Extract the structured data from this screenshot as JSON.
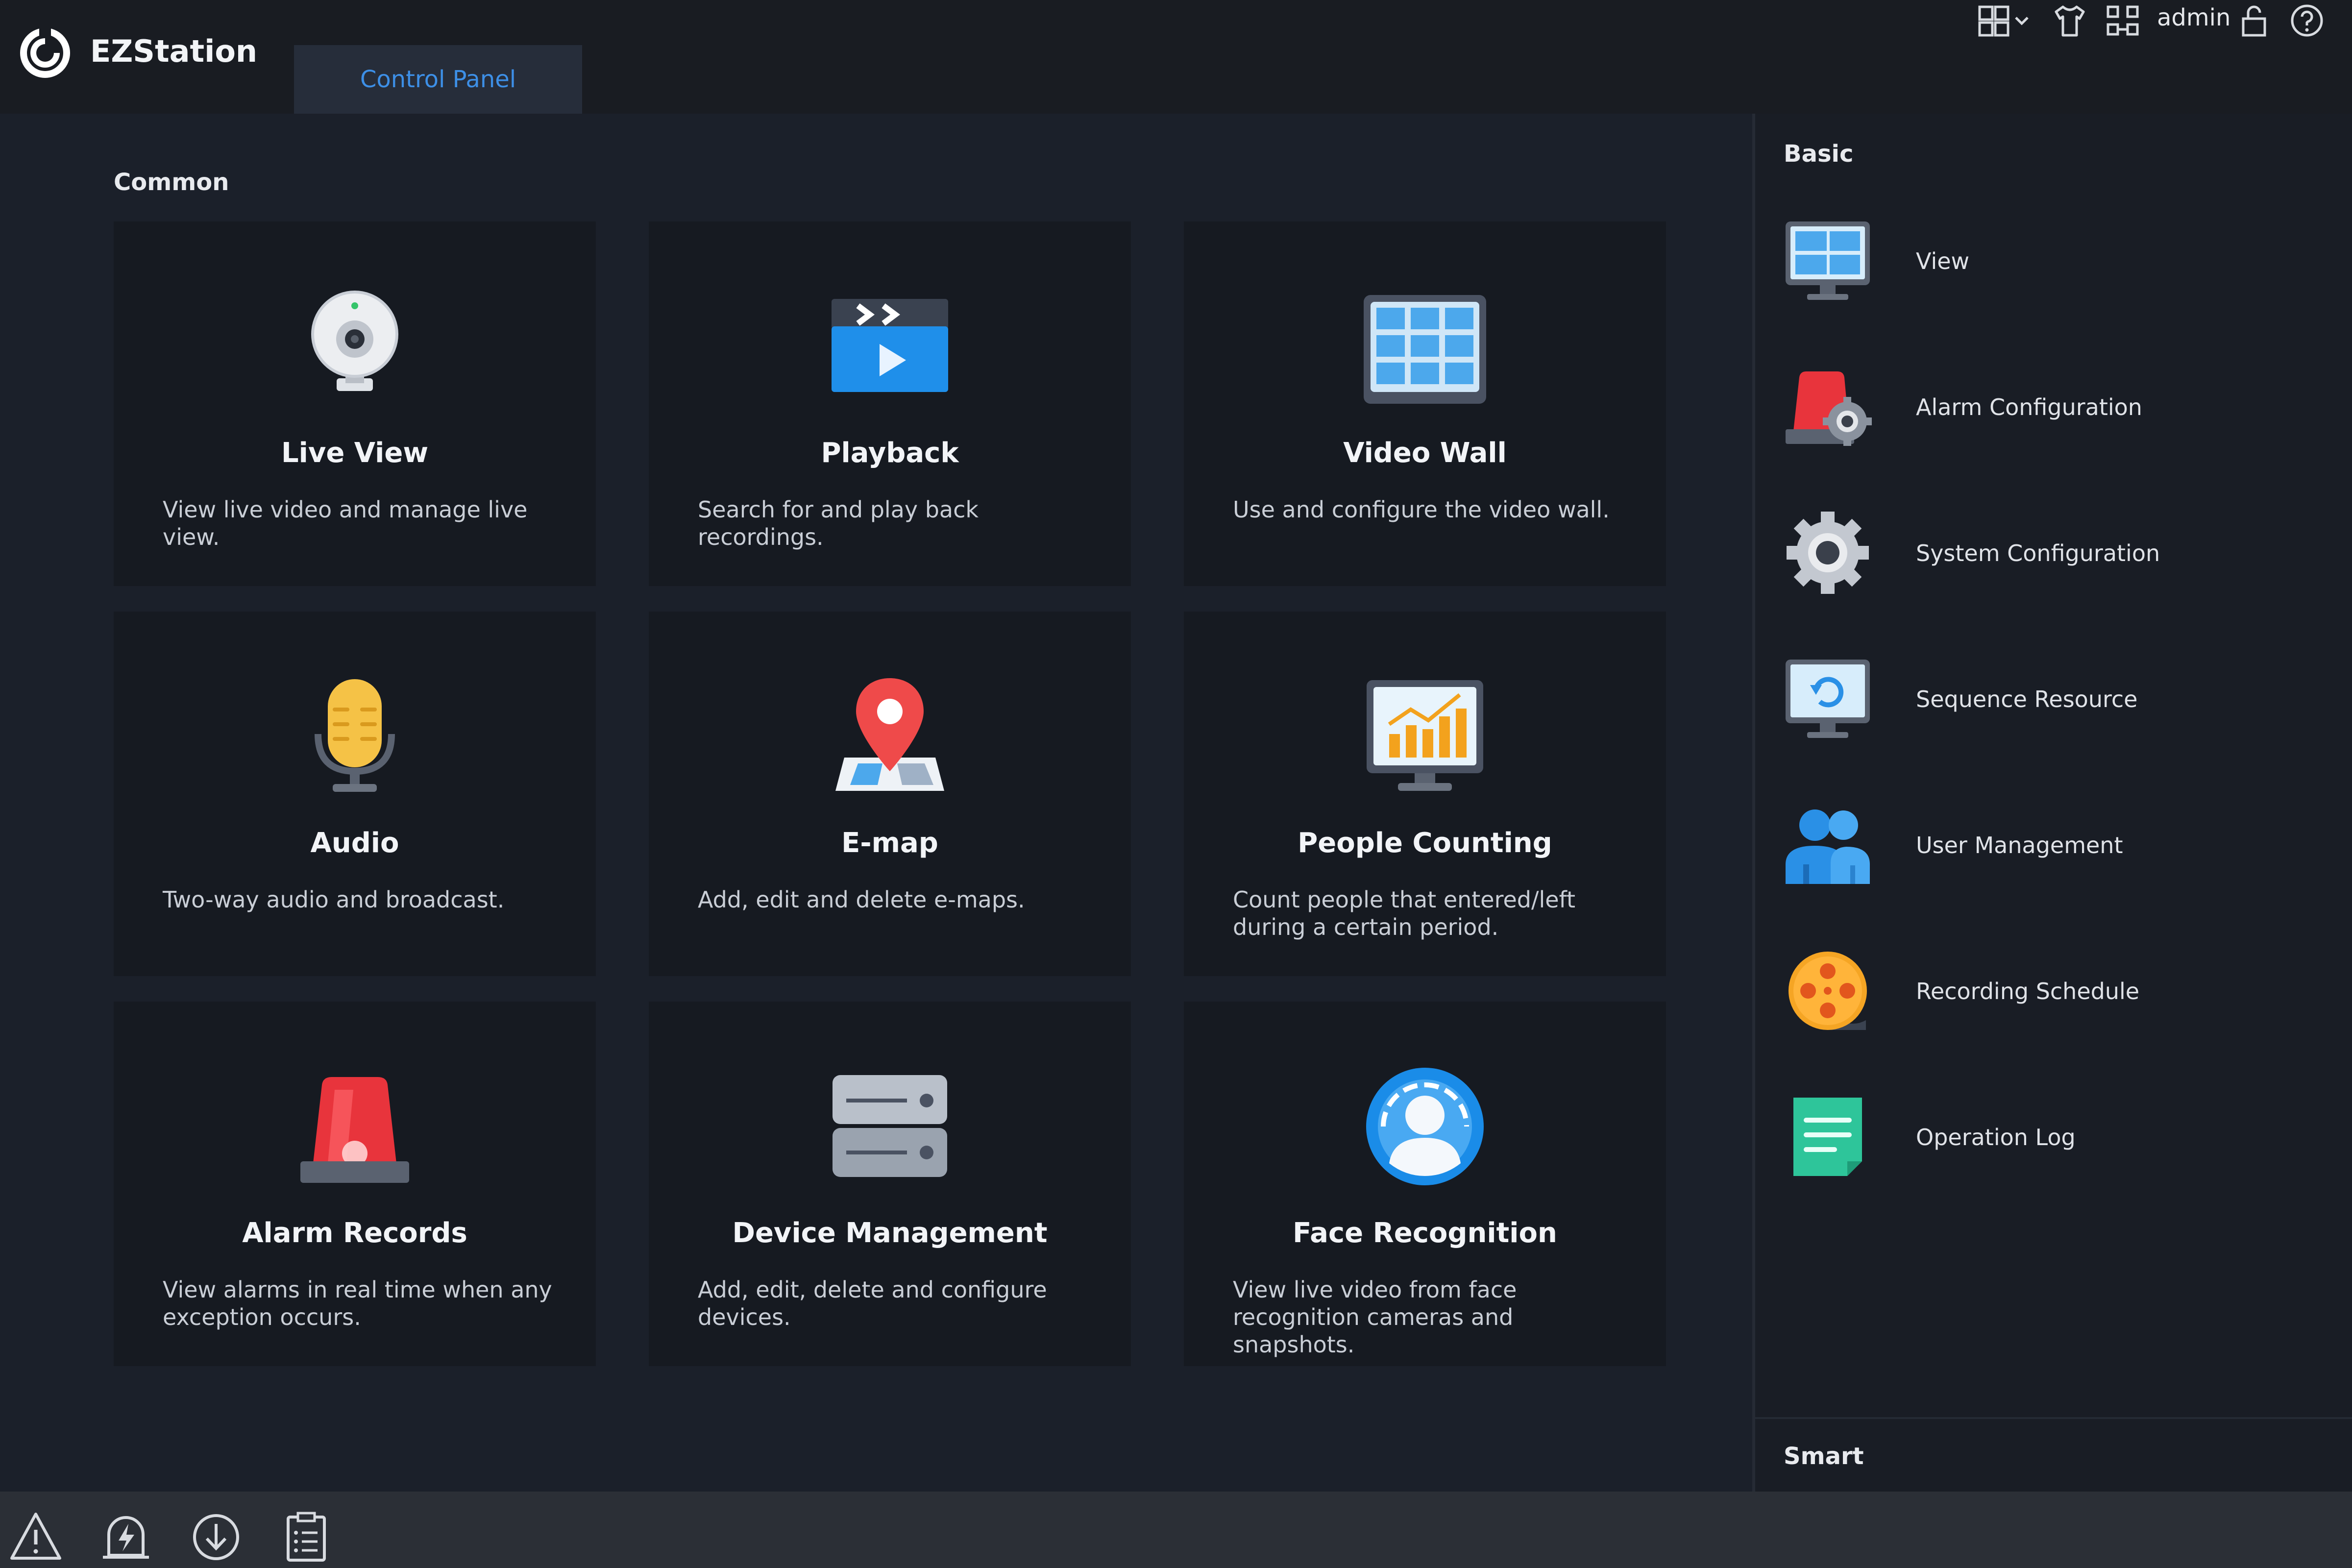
{
  "app": {
    "title": "EZStation"
  },
  "tabs": {
    "control_panel": "Control Panel"
  },
  "header": {
    "user": "admin",
    "icons": [
      "layout-grid-icon",
      "skin-icon",
      "connection-icon",
      "lock-icon",
      "help-icon"
    ]
  },
  "main": {
    "section_title": "Common",
    "cards": [
      {
        "title": "Live View",
        "desc": "View live video and manage live view.",
        "icon": "camera-icon"
      },
      {
        "title": "Playback",
        "desc": "Search for and play back recordings.",
        "icon": "playback-icon"
      },
      {
        "title": "Video Wall",
        "desc": "Use and configure the video wall.",
        "icon": "video-wall-icon"
      },
      {
        "title": "Audio",
        "desc": "Two-way audio and broadcast.",
        "icon": "microphone-icon"
      },
      {
        "title": "E-map",
        "desc": "Add, edit and delete e-maps.",
        "icon": "map-pin-icon"
      },
      {
        "title": "People Counting",
        "desc": "Count people that entered/left during a certain period.",
        "icon": "chart-monitor-icon"
      },
      {
        "title": "Alarm Records",
        "desc": "View alarms in real time when any exception occurs.",
        "icon": "alarm-light-icon"
      },
      {
        "title": "Device Management",
        "desc": "Add, edit, delete and configure devices.",
        "icon": "server-icon"
      },
      {
        "title": "Face Recognition",
        "desc": "View live video from face recognition cameras and snapshots.",
        "icon": "face-icon"
      }
    ]
  },
  "sidebar": {
    "basic_title": "Basic",
    "items": [
      {
        "label": "View",
        "icon": "monitor-view-icon"
      },
      {
        "label": "Alarm Configuration",
        "icon": "alarm-gear-icon"
      },
      {
        "label": "System Configuration",
        "icon": "gear-icon"
      },
      {
        "label": "Sequence Resource",
        "icon": "monitor-refresh-icon"
      },
      {
        "label": "User Management",
        "icon": "users-icon"
      },
      {
        "label": "Recording Schedule",
        "icon": "film-reel-icon"
      },
      {
        "label": "Operation Log",
        "icon": "log-icon"
      }
    ],
    "smart_title": "Smart"
  },
  "footer": {
    "icons": [
      "warning-icon",
      "alarm-bolt-icon",
      "download-icon",
      "task-list-icon"
    ]
  }
}
